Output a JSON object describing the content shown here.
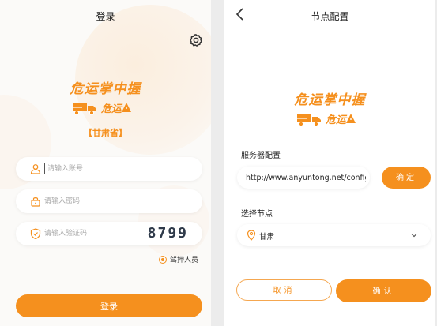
{
  "colors": {
    "accent": "#f5901e",
    "text": "#222222",
    "placeholder": "#aaaaaa"
  },
  "login": {
    "title": "登录",
    "settings_icon": "gear-icon",
    "logo": {
      "main": "危运掌中握",
      "brand": "危运"
    },
    "province": "【甘肃省】",
    "account": {
      "placeholder": "请输入账号",
      "value": ""
    },
    "password": {
      "placeholder": "请输入密码",
      "value": ""
    },
    "captcha": {
      "placeholder": "请输入验证码",
      "value": "",
      "code": "8799"
    },
    "role": {
      "label": "驾押人员",
      "selected": true
    },
    "submit_label": "登录"
  },
  "node_config": {
    "title": "节点配置",
    "back_icon": "chevron-left-icon",
    "logo": {
      "main": "危运掌中握",
      "brand": "危运"
    },
    "server_label": "服务器配置",
    "server_url": "http://www.anyuntong.net/config/",
    "confirm_url_label": "确定",
    "node_label": "选择节点",
    "node_value": "甘肃",
    "cancel_label": "取消",
    "ok_label": "确认"
  }
}
